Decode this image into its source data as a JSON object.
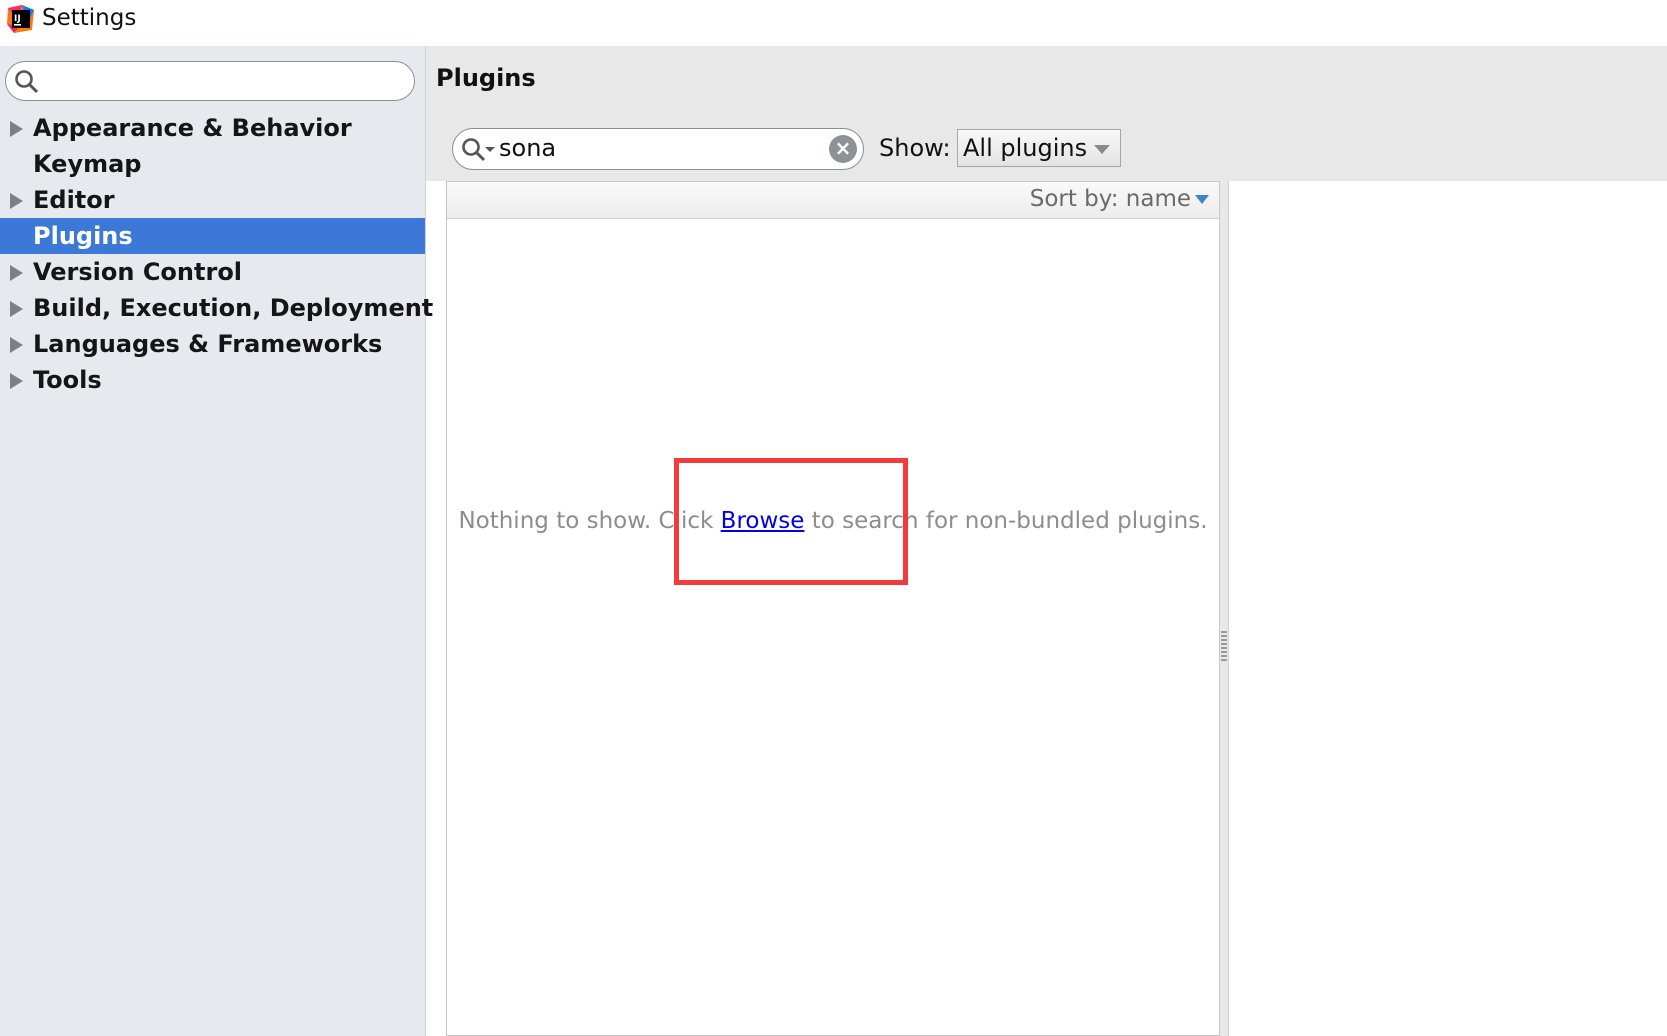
{
  "window": {
    "title": "Settings"
  },
  "sidebar": {
    "search": {
      "value": ""
    },
    "items": [
      {
        "label": "Appearance & Behavior",
        "expandable": true,
        "selected": false
      },
      {
        "label": "Keymap",
        "expandable": false,
        "selected": false
      },
      {
        "label": "Editor",
        "expandable": true,
        "selected": false
      },
      {
        "label": "Plugins",
        "expandable": false,
        "selected": true
      },
      {
        "label": "Version Control",
        "expandable": true,
        "selected": false
      },
      {
        "label": "Build, Execution, Deployment",
        "expandable": true,
        "selected": false
      },
      {
        "label": "Languages & Frameworks",
        "expandable": true,
        "selected": false
      },
      {
        "label": "Tools",
        "expandable": true,
        "selected": false
      }
    ]
  },
  "main": {
    "title": "Plugins",
    "search": {
      "value": "sona"
    },
    "show": {
      "label": "Show:",
      "selected": "All plugins"
    },
    "sort": {
      "label": "Sort by: name"
    },
    "empty": {
      "before": "Nothing to show. Click ",
      "link": "Browse",
      "after": " to search for non-bundled plugins."
    }
  },
  "colors": {
    "selection": "#3b78d8",
    "highlight_box": "#f03c3c",
    "link": "#0000ee"
  }
}
